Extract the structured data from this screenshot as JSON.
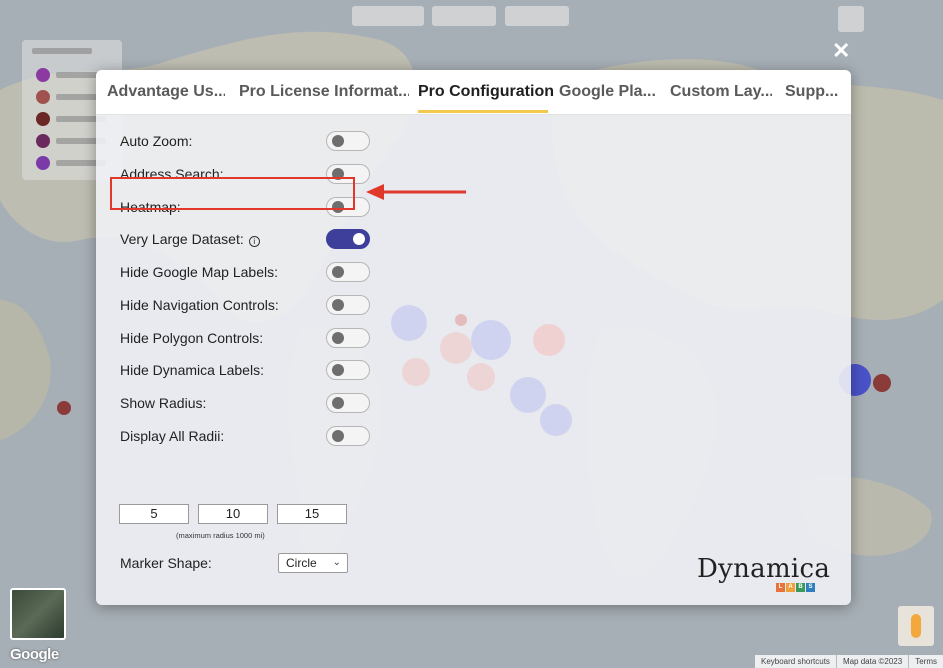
{
  "dialog": {
    "tabs": [
      {
        "label": "Advantage Us...",
        "active": false
      },
      {
        "label": "Pro License Informat...",
        "active": false
      },
      {
        "label": "Pro Configuration",
        "active": true
      },
      {
        "label": "Google Pla...",
        "active": false
      },
      {
        "label": "Custom Lay...",
        "active": false
      },
      {
        "label": "Supp...",
        "active": false
      }
    ],
    "close_icon": "close-x-icon",
    "settings": [
      {
        "label": "Auto Zoom:",
        "enabled": false
      },
      {
        "label": "Address Search:",
        "enabled": false
      },
      {
        "label": "Heatmap:",
        "enabled": false
      },
      {
        "label": "Very Large Dataset:",
        "enabled": true,
        "info_icon": true
      },
      {
        "label": "Hide Google Map Labels:",
        "enabled": false
      },
      {
        "label": "Hide Navigation Controls:",
        "enabled": false
      },
      {
        "label": "Hide Polygon Controls:",
        "enabled": false
      },
      {
        "label": "Hide Dynamica Labels:",
        "enabled": false
      },
      {
        "label": "Show Radius:",
        "enabled": false
      },
      {
        "label": "Display All Radii:",
        "enabled": false
      }
    ],
    "radii": [
      "5",
      "10",
      "15"
    ],
    "radius_note": "(maximum radius 1000 mi)",
    "marker_shape": {
      "label": "Marker Shape:",
      "value": "Circle"
    },
    "brand": "Dynamica",
    "labs_letters": [
      "L",
      "A",
      "B",
      "S"
    ],
    "labs_colors": [
      "#e9723a",
      "#f0a03a",
      "#3a9a5a",
      "#2f7fbf"
    ],
    "toggle_on_color": "#3d3f9b",
    "annotation_color": "#e2382b"
  },
  "map": {
    "google_logo": "Google",
    "footer": [
      "Keyboard shortcuts",
      "Map data ©2023",
      "Terms"
    ]
  }
}
